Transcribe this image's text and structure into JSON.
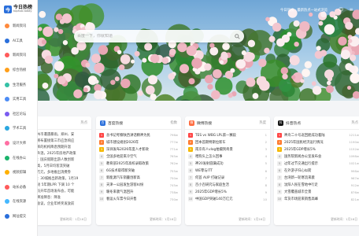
{
  "logo": {
    "mark": "今",
    "name_cn": "今日热榜",
    "name_en": "tophub.today"
  },
  "sidebar": {
    "items": [
      {
        "label": "新闻资讯",
        "color": "#ff8a3d"
      },
      {
        "label": "AI工具",
        "color": "#2a6fdb"
      },
      {
        "label": "新闻资讯",
        "color": "#ff5a5a"
      },
      {
        "label": "综合热榜",
        "color": "#ff9f1a"
      },
      {
        "label": "生活服务",
        "color": "#34c1a6"
      },
      {
        "label": "实用工具",
        "color": "#4c8cf5"
      },
      {
        "label": "社区论坛",
        "color": "#7a5cf0"
      },
      {
        "label": "学术工具",
        "color": "#2ba7e0"
      },
      {
        "label": "设计大师",
        "color": "#ff6fa3"
      },
      {
        "label": "在线办公",
        "color": "#1ab36b"
      },
      {
        "label": "视频剪辑",
        "color": "#ffb000"
      },
      {
        "label": "站长必备",
        "color": "#ff5a5a"
      },
      {
        "label": "在线资源",
        "color": "#45b8ff"
      },
      {
        "label": "网址提交",
        "color": "#2a6fdb"
      }
    ]
  },
  "header": {
    "tip": "今日热榜 · 最新热点一站式浏览"
  },
  "search": {
    "placeholder": "百度一下，你就知道"
  },
  "cards": {
    "partial": {
      "head_right": "热点",
      "lines": [
        "州市遭遇暴雨，郑州、安",
        "将布置接第三市应急响应",
        "率的机构降息预期升温",
        "升温，2025年房地产政策",
        "：国庆假期出游人数创新",
        "高，5月日均客流突破",
        "万元，多地推出消费券",
        "：30城推出新政策，1月19",
        "短 5年期LPR 下调 10 个",
        "员开年首场发布会，可能",
        "降准降息：降准",
        "会议，企业年终奖发放前"
      ],
      "footer": "更新时间：1月16日"
    },
    "baidu": {
      "title": "百度热搜",
      "badge": "百",
      "color": "#2a6fdb",
      "head_right": "指数",
      "rows": [
        {
          "t": "总书记考察陕西讲话精神为民",
          "h": "796w"
        },
        {
          "t": "城市建设规划2026年",
          "h": "777w"
        },
        {
          "t": "深圳发布2026年度人才新政",
          "h": "771w"
        },
        {
          "t": "全国多地迎来冷空气",
          "h": "765w"
        },
        {
          "t": "教育部2025年高校录取政策",
          "h": "762w"
        },
        {
          "t": "6G技术取得新突破",
          "h": "755w"
        },
        {
          "t": "新能源汽车销量创新高",
          "h": "750w"
        },
        {
          "t": "天津一公园发生游客纠纷",
          "h": "745w"
        },
        {
          "t": "暖冬来袭气温回升",
          "h": "738w"
        },
        {
          "t": "春运火车票今日开售",
          "h": "730w"
        }
      ],
      "footer": "更新时间：1月16日"
    },
    "weibo": {
      "title": "微博热搜",
      "badge": "微",
      "color": "#ff6a3d",
      "head_right": "热度",
      "rows": [
        {
          "t": "TES vs WBG LPL第一赛段",
          "h": "1"
        },
        {
          "t": "回本首期特斯拉新车",
          "h": "2"
        },
        {
          "t": "南京有人vlog拍摄到奇景",
          "h": "3"
        },
        {
          "t": "喂狗头上怎么回事",
          "h": "4"
        },
        {
          "t": "神20发射圆满成功",
          "h": "5"
        },
        {
          "t": "WE零与ITT",
          "h": "6"
        },
        {
          "t": "何首 AUP 打破记录",
          "h": "7"
        },
        {
          "t": "百小百研究与家庭生活",
          "h": "8"
        },
        {
          "t": "2025年GDP增长5%",
          "h": "9"
        },
        {
          "t": "中国GDP突破140万亿元",
          "h": "10"
        }
      ],
      "footer": "更新时间：1月16日"
    },
    "douyin": {
      "title": "抖音热点",
      "badge": "抖",
      "color": "#111111",
      "head_right": "热点",
      "rows": [
        {
          "t": "神舟二十号返回舱成功着陆",
          "h": "1211w"
        },
        {
          "t": "2025年国民经济运行情况",
          "h": "1190w"
        },
        {
          "t": "2025年GDP增长5%",
          "h": "1152w"
        },
        {
          "t": "国务院新闻办公室发布会",
          "h": "1098w"
        },
        {
          "t": "过年过节交通出行提示",
          "h": "1021w"
        },
        {
          "t": "在外游子归心似箭",
          "h": "998w"
        },
        {
          "t": "台湾新一轮寒流来袭",
          "h": "967w"
        },
        {
          "t": "沈阳人民在雪地中行走",
          "h": "912w"
        },
        {
          "t": "大雪覆盖城市全景",
          "h": "876w"
        },
        {
          "t": "年货市场迎来销售高峰",
          "h": "821w"
        }
      ],
      "footer": "更新时间：1月16日"
    }
  }
}
